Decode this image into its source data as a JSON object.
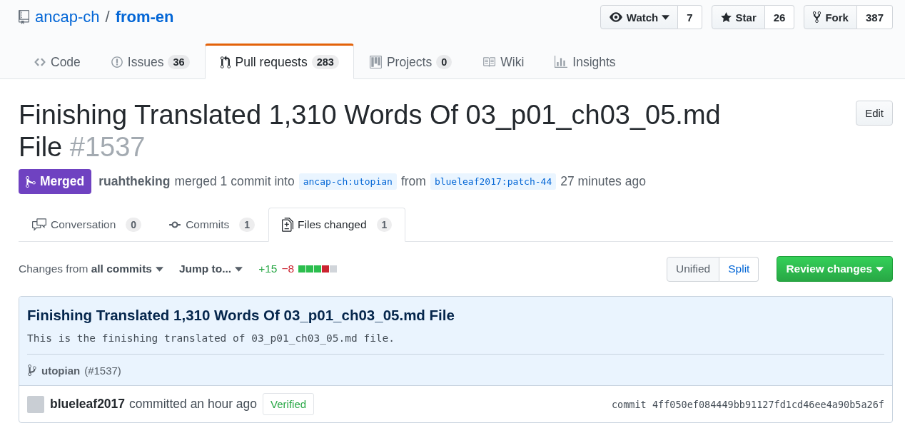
{
  "repo": {
    "owner": "ancap-ch",
    "separator": "/",
    "name": "from-en",
    "actions": [
      {
        "kind": "watch",
        "label": "Watch",
        "count": "7"
      },
      {
        "kind": "star",
        "label": "Star",
        "count": "26"
      },
      {
        "kind": "fork",
        "label": "Fork",
        "count": "387"
      }
    ]
  },
  "repo_tabs": [
    {
      "kind": "code",
      "label": "Code",
      "selected": false
    },
    {
      "kind": "issues",
      "label": "Issues",
      "count": "36",
      "selected": false
    },
    {
      "kind": "pulls",
      "label": "Pull requests",
      "count": "283",
      "selected": true
    },
    {
      "kind": "projects",
      "label": "Projects",
      "count": "0",
      "selected": false
    },
    {
      "kind": "wiki",
      "label": "Wiki",
      "selected": false
    },
    {
      "kind": "insights",
      "label": "Insights",
      "selected": false
    }
  ],
  "pr": {
    "title": "Finishing Translated 1,310 Words Of 03_p01_ch03_05.md File",
    "number": "#1537",
    "edit_button": "Edit",
    "status": {
      "label": "Merged"
    },
    "author": "ruahtheking",
    "summary": "merged 1 commit into",
    "base": "ancap-ch:utopian",
    "from": "from",
    "head": "blueleaf2017:patch-44",
    "time": "27 minutes ago"
  },
  "pr_tabs": [
    {
      "kind": "conversation",
      "label": "Conversation",
      "count": "0",
      "selected": false
    },
    {
      "kind": "commits",
      "label": "Commits",
      "count": "1",
      "selected": false
    },
    {
      "kind": "files",
      "label": "Files changed",
      "count": "1",
      "selected": true
    }
  ],
  "toolbar": {
    "changes_prefix": "Changes from",
    "changes_value": "all commits",
    "jump": "Jump to...",
    "additions": "+15",
    "deletions": "−8",
    "diffstat": [
      {
        "color": "#2cbe4e"
      },
      {
        "color": "#2cbe4e"
      },
      {
        "color": "#2cbe4e"
      },
      {
        "color": "#cb2431"
      },
      {
        "color": "#d1d5da"
      }
    ],
    "view_modes": [
      {
        "label": "Unified",
        "selected": true
      },
      {
        "label": "Split",
        "selected": false
      }
    ],
    "review_button": "Review changes"
  },
  "commit": {
    "title": "Finishing Translated 1,310 Words Of 03_p01_ch03_05.md File",
    "body": "This is the finishing translated of 03_p01_ch03_05.md file.",
    "branch": "utopian",
    "ref": "(#1537)",
    "author": "blueleaf2017",
    "action": "committed an hour ago",
    "verified": "Verified",
    "sha": "commit 4ff050ef084449bb91127fd1cd46ee4a90b5a26f"
  }
}
